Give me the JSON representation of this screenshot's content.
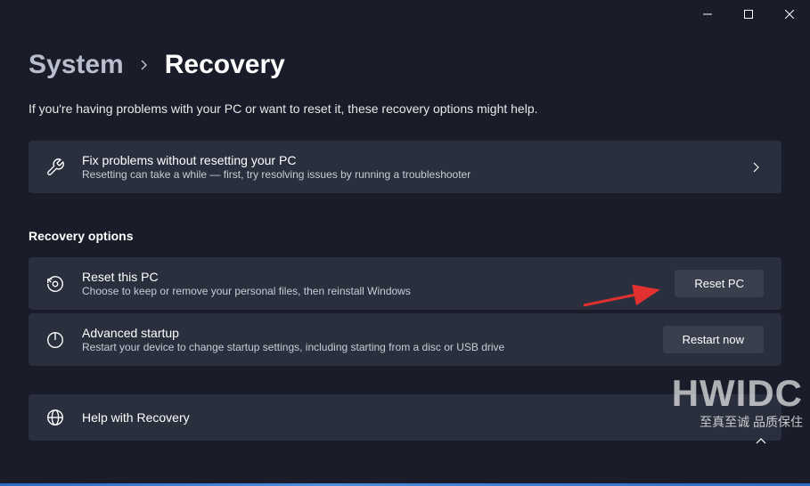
{
  "breadcrumb": {
    "parent": "System",
    "current": "Recovery"
  },
  "subtitle": "If you're having problems with your PC or want to reset it, these recovery options might help.",
  "fix_card": {
    "title": "Fix problems without resetting your PC",
    "desc": "Resetting can take a while — first, try resolving issues by running a troubleshooter"
  },
  "section_heading": "Recovery options",
  "reset_card": {
    "title": "Reset this PC",
    "desc": "Choose to keep or remove your personal files, then reinstall Windows",
    "button": "Reset PC"
  },
  "advanced_card": {
    "title": "Advanced startup",
    "desc": "Restart your device to change startup settings, including starting from a disc or USB drive",
    "button": "Restart now"
  },
  "help_card": {
    "title": "Help with Recovery"
  },
  "watermark": {
    "big": "HWIDC",
    "small": "至真至诚 品质保住"
  }
}
